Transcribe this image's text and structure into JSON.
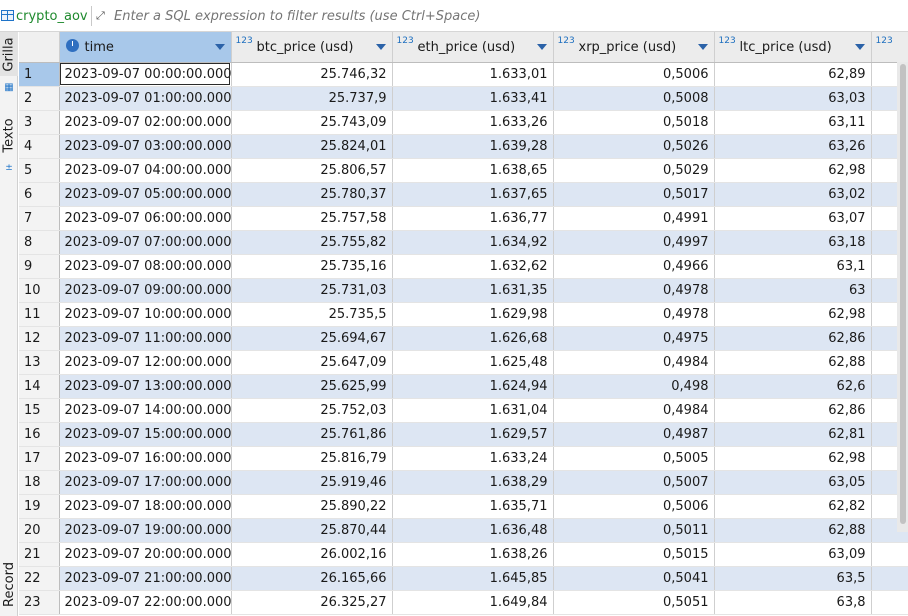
{
  "header": {
    "tab_name": "crypto_aov",
    "filter_placeholder": "Enter a SQL expression to filter results (use Ctrl+Space)"
  },
  "side_panel": {
    "tabs": [
      "Grilla",
      "Texto",
      "Record"
    ]
  },
  "columns": [
    {
      "name": "time",
      "type_badge": ""
    },
    {
      "name": "btc_price (usd)",
      "type_badge": "123"
    },
    {
      "name": "eth_price (usd)",
      "type_badge": "123"
    },
    {
      "name": "xrp_price (usd)",
      "type_badge": "123"
    },
    {
      "name": "ltc_price (usd)",
      "type_badge": "123"
    },
    {
      "name": "",
      "type_badge": "123"
    }
  ],
  "rows": [
    {
      "n": "1",
      "time": "2023-09-07 00:00:00.000",
      "btc": "25.746,32",
      "eth": "1.633,01",
      "xrp": "0,5006",
      "ltc": "62,89"
    },
    {
      "n": "2",
      "time": "2023-09-07 01:00:00.000",
      "btc": "25.737,9",
      "eth": "1.633,41",
      "xrp": "0,5008",
      "ltc": "63,03"
    },
    {
      "n": "3",
      "time": "2023-09-07 02:00:00.000",
      "btc": "25.743,09",
      "eth": "1.633,26",
      "xrp": "0,5018",
      "ltc": "63,11"
    },
    {
      "n": "4",
      "time": "2023-09-07 03:00:00.000",
      "btc": "25.824,01",
      "eth": "1.639,28",
      "xrp": "0,5026",
      "ltc": "63,26"
    },
    {
      "n": "5",
      "time": "2023-09-07 04:00:00.000",
      "btc": "25.806,57",
      "eth": "1.638,65",
      "xrp": "0,5029",
      "ltc": "62,98"
    },
    {
      "n": "6",
      "time": "2023-09-07 05:00:00.000",
      "btc": "25.780,37",
      "eth": "1.637,65",
      "xrp": "0,5017",
      "ltc": "63,02"
    },
    {
      "n": "7",
      "time": "2023-09-07 06:00:00.000",
      "btc": "25.757,58",
      "eth": "1.636,77",
      "xrp": "0,4991",
      "ltc": "63,07"
    },
    {
      "n": "8",
      "time": "2023-09-07 07:00:00.000",
      "btc": "25.755,82",
      "eth": "1.634,92",
      "xrp": "0,4997",
      "ltc": "63,18"
    },
    {
      "n": "9",
      "time": "2023-09-07 08:00:00.000",
      "btc": "25.735,16",
      "eth": "1.632,62",
      "xrp": "0,4966",
      "ltc": "63,1"
    },
    {
      "n": "10",
      "time": "2023-09-07 09:00:00.000",
      "btc": "25.731,03",
      "eth": "1.631,35",
      "xrp": "0,4978",
      "ltc": "63"
    },
    {
      "n": "11",
      "time": "2023-09-07 10:00:00.000",
      "btc": "25.735,5",
      "eth": "1.629,98",
      "xrp": "0,4978",
      "ltc": "62,98"
    },
    {
      "n": "12",
      "time": "2023-09-07 11:00:00.000",
      "btc": "25.694,67",
      "eth": "1.626,68",
      "xrp": "0,4975",
      "ltc": "62,86"
    },
    {
      "n": "13",
      "time": "2023-09-07 12:00:00.000",
      "btc": "25.647,09",
      "eth": "1.625,48",
      "xrp": "0,4984",
      "ltc": "62,88"
    },
    {
      "n": "14",
      "time": "2023-09-07 13:00:00.000",
      "btc": "25.625,99",
      "eth": "1.624,94",
      "xrp": "0,498",
      "ltc": "62,6"
    },
    {
      "n": "15",
      "time": "2023-09-07 14:00:00.000",
      "btc": "25.752,03",
      "eth": "1.631,04",
      "xrp": "0,4984",
      "ltc": "62,86"
    },
    {
      "n": "16",
      "time": "2023-09-07 15:00:00.000",
      "btc": "25.761,86",
      "eth": "1.629,57",
      "xrp": "0,4987",
      "ltc": "62,81"
    },
    {
      "n": "17",
      "time": "2023-09-07 16:00:00.000",
      "btc": "25.816,79",
      "eth": "1.633,24",
      "xrp": "0,5005",
      "ltc": "62,98"
    },
    {
      "n": "18",
      "time": "2023-09-07 17:00:00.000",
      "btc": "25.919,46",
      "eth": "1.638,29",
      "xrp": "0,5007",
      "ltc": "63,05"
    },
    {
      "n": "19",
      "time": "2023-09-07 18:00:00.000",
      "btc": "25.890,22",
      "eth": "1.635,71",
      "xrp": "0,5006",
      "ltc": "62,82"
    },
    {
      "n": "20",
      "time": "2023-09-07 19:00:00.000",
      "btc": "25.870,44",
      "eth": "1.636,48",
      "xrp": "0,5011",
      "ltc": "62,88"
    },
    {
      "n": "21",
      "time": "2023-09-07 20:00:00.000",
      "btc": "26.002,16",
      "eth": "1.638,26",
      "xrp": "0,5015",
      "ltc": "63,09"
    },
    {
      "n": "22",
      "time": "2023-09-07 21:00:00.000",
      "btc": "26.165,66",
      "eth": "1.645,85",
      "xrp": "0,5041",
      "ltc": "63,5"
    },
    {
      "n": "23",
      "time": "2023-09-07 22:00:00.000",
      "btc": "26.325,27",
      "eth": "1.649,84",
      "xrp": "0,5051",
      "ltc": "63,8"
    }
  ],
  "colors": {
    "selected": "#a8c8ea",
    "alt_row": "#dde6f3",
    "tab_name": "#1f8a2e",
    "accent": "#1e73c8"
  }
}
